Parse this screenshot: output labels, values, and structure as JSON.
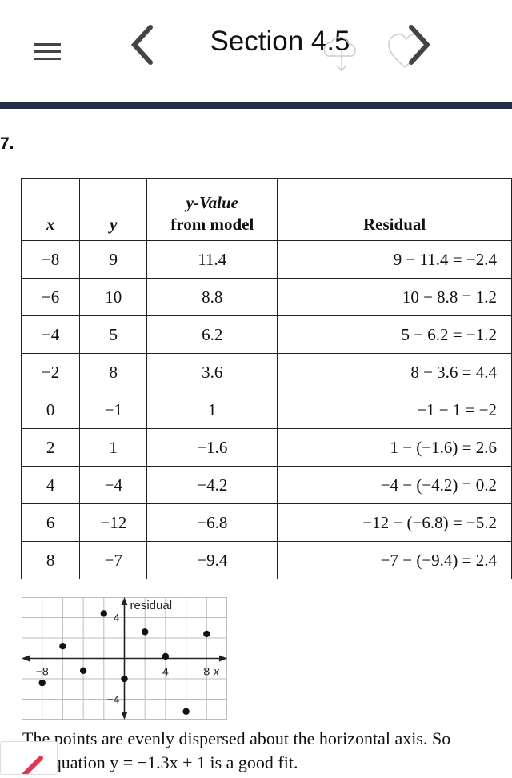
{
  "header": {
    "title": "Section 4.5",
    "icons": [
      "menu-icon",
      "chevron-left-icon",
      "cloud-download-icon",
      "heart-icon",
      "chevron-right-icon"
    ]
  },
  "exercise": {
    "number": "7."
  },
  "table": {
    "headers": {
      "x": "x",
      "y": "y",
      "model_line1": "y-Value",
      "model_line2": "from model",
      "residual": "Residual"
    },
    "rows": [
      {
        "x": "−8",
        "y": "9",
        "model": "11.4",
        "residual": "9 − 11.4 = −2.4"
      },
      {
        "x": "−6",
        "y": "10",
        "model": "8.8",
        "residual": "10 − 8.8 = 1.2"
      },
      {
        "x": "−4",
        "y": "5",
        "model": "6.2",
        "residual": "5 − 6.2 = −1.2"
      },
      {
        "x": "−2",
        "y": "8",
        "model": "3.6",
        "residual": "8 − 3.6 = 4.4"
      },
      {
        "x": "0",
        "y": "−1",
        "model": "1",
        "residual": "−1 − 1 = −2"
      },
      {
        "x": "2",
        "y": "1",
        "model": "−1.6",
        "residual": "1 − (−1.6) = 2.6"
      },
      {
        "x": "4",
        "y": "−4",
        "model": "−4.2",
        "residual": "−4 − (−4.2) = 0.2"
      },
      {
        "x": "6",
        "y": "−12",
        "model": "−6.8",
        "residual": "−12 − (−6.8) = −5.2"
      },
      {
        "x": "8",
        "y": "−7",
        "model": "−9.4",
        "residual": "−7 − (−9.4) = 2.4"
      }
    ]
  },
  "chart_data": {
    "type": "scatter",
    "title": "",
    "xlabel": "x",
    "ylabel": "residual",
    "xlim": [
      -10,
      10
    ],
    "ylim": [
      -6,
      6
    ],
    "grid": true,
    "grid_step": 2,
    "x_tick_labels": [
      "−8",
      "4",
      "8"
    ],
    "x_tick_values": [
      -8,
      4,
      8
    ],
    "y_tick_labels": [
      "4",
      "−4"
    ],
    "y_tick_values": [
      4,
      -4
    ],
    "x": [
      -8,
      -6,
      -4,
      -2,
      0,
      2,
      4,
      6,
      8
    ],
    "y": [
      -2.4,
      1.2,
      -1.2,
      4.4,
      -2,
      2.6,
      0.2,
      -5.2,
      2.4
    ]
  },
  "footer": {
    "line1": "The points are evenly dispersed about the horizontal axis. So",
    "line2": "equation y = −1.3x + 1 is a good fit."
  }
}
